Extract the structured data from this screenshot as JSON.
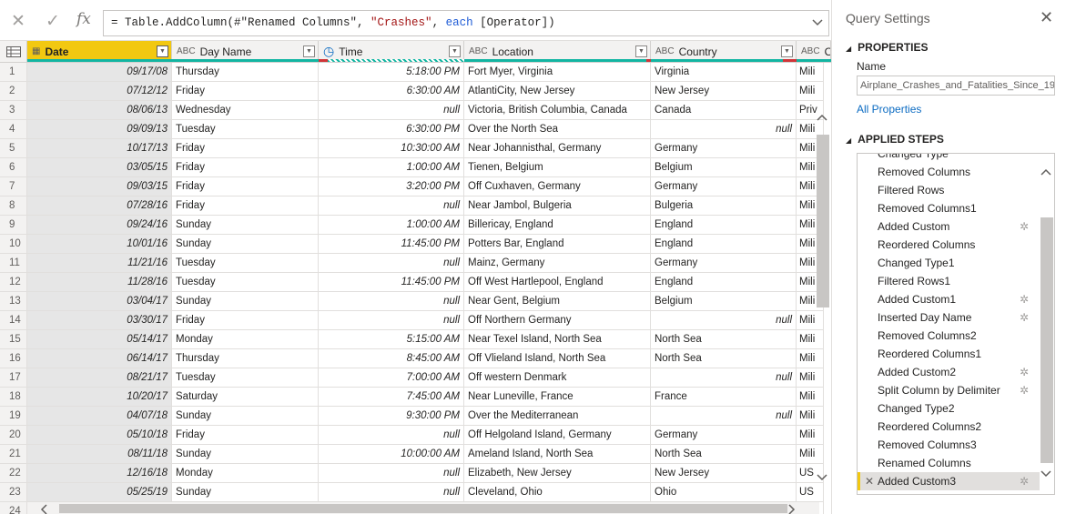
{
  "formula": {
    "cancel_icon": "✕",
    "confirm_icon": "✓",
    "fx_label": "fx",
    "text_a": "= Table.AddColumn(#\"Renamed Columns\", ",
    "text_str": "\"Crashes\"",
    "text_b": ", ",
    "text_kw": "each",
    "text_c": " [Operator])"
  },
  "columns": [
    {
      "name": "Date",
      "type": "▦"
    },
    {
      "name": "Day Name",
      "type": "ABC"
    },
    {
      "name": "Time",
      "type": "◷"
    },
    {
      "name": "Location",
      "type": "ABC"
    },
    {
      "name": "Country",
      "type": "ABC"
    },
    {
      "name": "Op",
      "type": "ABC"
    }
  ],
  "rows": [
    {
      "n": "1",
      "date": "09/17/08",
      "day": "Thursday",
      "time": "5:18:00 PM",
      "loc": "Fort Myer, Virginia",
      "cty": "Virginia",
      "op": "Mili"
    },
    {
      "n": "2",
      "date": "07/12/12",
      "day": "Friday",
      "time": "6:30:00 AM",
      "loc": "AtlantiCity, New Jersey",
      "cty": "New Jersey",
      "op": "Mili"
    },
    {
      "n": "3",
      "date": "08/06/13",
      "day": "Wednesday",
      "time": "null",
      "loc": "Victoria, British Columbia, Canada",
      "cty": "Canada",
      "op": "Priv"
    },
    {
      "n": "4",
      "date": "09/09/13",
      "day": "Tuesday",
      "time": "6:30:00 PM",
      "loc": "Over the North Sea",
      "cty": "null",
      "op": "Mili"
    },
    {
      "n": "5",
      "date": "10/17/13",
      "day": "Friday",
      "time": "10:30:00 AM",
      "loc": "Near Johannisthal, Germany",
      "cty": "Germany",
      "op": "Mili"
    },
    {
      "n": "6",
      "date": "03/05/15",
      "day": "Friday",
      "time": "1:00:00 AM",
      "loc": "Tienen, Belgium",
      "cty": "Belgium",
      "op": "Mili"
    },
    {
      "n": "7",
      "date": "09/03/15",
      "day": "Friday",
      "time": "3:20:00 PM",
      "loc": "Off Cuxhaven, Germany",
      "cty": "Germany",
      "op": "Mili"
    },
    {
      "n": "8",
      "date": "07/28/16",
      "day": "Friday",
      "time": "null",
      "loc": "Near Jambol, Bulgeria",
      "cty": "Bulgeria",
      "op": "Mili"
    },
    {
      "n": "9",
      "date": "09/24/16",
      "day": "Sunday",
      "time": "1:00:00 AM",
      "loc": "Billericay, England",
      "cty": "England",
      "op": "Mili"
    },
    {
      "n": "10",
      "date": "10/01/16",
      "day": "Sunday",
      "time": "11:45:00 PM",
      "loc": "Potters Bar, England",
      "cty": "England",
      "op": "Mili"
    },
    {
      "n": "11",
      "date": "11/21/16",
      "day": "Tuesday",
      "time": "null",
      "loc": "Mainz, Germany",
      "cty": "Germany",
      "op": "Mili"
    },
    {
      "n": "12",
      "date": "11/28/16",
      "day": "Tuesday",
      "time": "11:45:00 PM",
      "loc": "Off West Hartlepool, England",
      "cty": "England",
      "op": "Mili"
    },
    {
      "n": "13",
      "date": "03/04/17",
      "day": "Sunday",
      "time": "null",
      "loc": "Near Gent, Belgium",
      "cty": "Belgium",
      "op": "Mili"
    },
    {
      "n": "14",
      "date": "03/30/17",
      "day": "Friday",
      "time": "null",
      "loc": "Off Northern Germany",
      "cty": "null",
      "op": "Mili"
    },
    {
      "n": "15",
      "date": "05/14/17",
      "day": "Monday",
      "time": "5:15:00 AM",
      "loc": "Near Texel Island, North Sea",
      "cty": "North Sea",
      "op": "Mili"
    },
    {
      "n": "16",
      "date": "06/14/17",
      "day": "Thursday",
      "time": "8:45:00 AM",
      "loc": "Off Vlieland Island, North Sea",
      "cty": "North Sea",
      "op": "Mili"
    },
    {
      "n": "17",
      "date": "08/21/17",
      "day": "Tuesday",
      "time": "7:00:00 AM",
      "loc": "Off western Denmark",
      "cty": "null",
      "op": "Mili"
    },
    {
      "n": "18",
      "date": "10/20/17",
      "day": "Saturday",
      "time": "7:45:00 AM",
      "loc": "Near Luneville, France",
      "cty": "France",
      "op": "Mili"
    },
    {
      "n": "19",
      "date": "04/07/18",
      "day": "Sunday",
      "time": "9:30:00 PM",
      "loc": "Over the Mediterranean",
      "cty": "null",
      "op": "Mili"
    },
    {
      "n": "20",
      "date": "05/10/18",
      "day": "Friday",
      "time": "null",
      "loc": "Off Helgoland Island, Germany",
      "cty": "Germany",
      "op": "Mili"
    },
    {
      "n": "21",
      "date": "08/11/18",
      "day": "Sunday",
      "time": "10:00:00 AM",
      "loc": "Ameland Island, North Sea",
      "cty": "North Sea",
      "op": "Mili"
    },
    {
      "n": "22",
      "date": "12/16/18",
      "day": "Monday",
      "time": "null",
      "loc": "Elizabeth, New Jersey",
      "cty": "New Jersey",
      "op": "US"
    },
    {
      "n": "23",
      "date": "05/25/19",
      "day": "Sunday",
      "time": "null",
      "loc": "Cleveland, Ohio",
      "cty": "Ohio",
      "op": "US"
    },
    {
      "n": "24",
      "date": "",
      "day": "",
      "time": "",
      "loc": "",
      "cty": "",
      "op": ""
    }
  ],
  "pane": {
    "title": "Query Settings",
    "close_icon": "✕",
    "properties_heading": "PROPERTIES",
    "name_label": "Name",
    "name_value": "Airplane_Crashes_and_Fatalities_Since_19",
    "all_properties_link": "All Properties",
    "applied_steps_heading": "APPLIED STEPS",
    "steps": [
      {
        "label": "Changed Type",
        "gear": false
      },
      {
        "label": "Removed Columns",
        "gear": false
      },
      {
        "label": "Filtered Rows",
        "gear": false
      },
      {
        "label": "Removed Columns1",
        "gear": false
      },
      {
        "label": "Added Custom",
        "gear": true
      },
      {
        "label": "Reordered Columns",
        "gear": false
      },
      {
        "label": "Changed Type1",
        "gear": false
      },
      {
        "label": "Filtered Rows1",
        "gear": false
      },
      {
        "label": "Added Custom1",
        "gear": true
      },
      {
        "label": "Inserted Day Name",
        "gear": true
      },
      {
        "label": "Removed Columns2",
        "gear": false
      },
      {
        "label": "Reordered Columns1",
        "gear": false
      },
      {
        "label": "Added Custom2",
        "gear": true
      },
      {
        "label": "Split Column by Delimiter",
        "gear": true
      },
      {
        "label": "Changed Type2",
        "gear": false
      },
      {
        "label": "Reordered Columns2",
        "gear": false
      },
      {
        "label": "Removed Columns3",
        "gear": false
      },
      {
        "label": "Renamed Columns",
        "gear": false
      },
      {
        "label": "Added Custom3",
        "gear": true,
        "selected": true
      }
    ]
  }
}
